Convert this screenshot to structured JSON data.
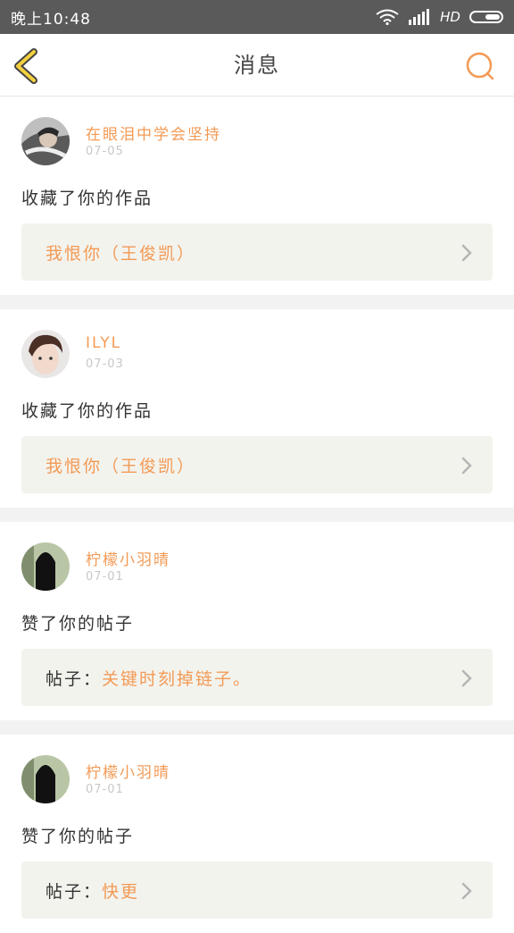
{
  "status_bar": {
    "time": "晚上10:48",
    "network": "HD"
  },
  "header": {
    "title": "消息"
  },
  "colors": {
    "accent": "#f39a55",
    "status_bar_bg": "#5a5a5a",
    "back_icon": "#f4d03f"
  },
  "messages": [
    {
      "user": "在眼泪中学会坚持",
      "date": "07-05",
      "action": "收藏了你的作品",
      "ref_label": "",
      "ref_value": "我恨你（王俊凯）"
    },
    {
      "user": "ILYL",
      "date": "07-03",
      "action": "收藏了你的作品",
      "ref_label": "",
      "ref_value": "我恨你（王俊凯）"
    },
    {
      "user": "柠檬小羽晴",
      "date": "07-01",
      "action": "赞了你的帖子",
      "ref_label": "帖子：",
      "ref_value": "关键时刻掉链子。"
    },
    {
      "user": "柠檬小羽晴",
      "date": "07-01",
      "action": "赞了你的帖子",
      "ref_label": "帖子：",
      "ref_value": "快更"
    }
  ]
}
